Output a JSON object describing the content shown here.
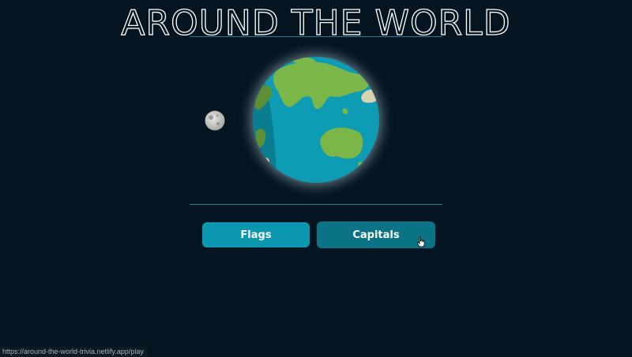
{
  "app": {
    "title": "AROUND THE WORLD"
  },
  "modes": {
    "flags_label": "Flags",
    "capitals_label": "Capitals"
  },
  "status_bar": {
    "url": "https://around-the-world-trivia.netlify.app/play"
  },
  "colors": {
    "background": "#041521",
    "accent_line": "#2a7f98",
    "flags_button": "#0b97b0",
    "capitals_button_hover": "#0a7486",
    "ocean": "#0e9bb4",
    "land": "#7ab648"
  },
  "icons": {
    "globe": "earth-illustration",
    "moon": "moon-illustration",
    "cursor": "hand-pointer-cursor"
  }
}
